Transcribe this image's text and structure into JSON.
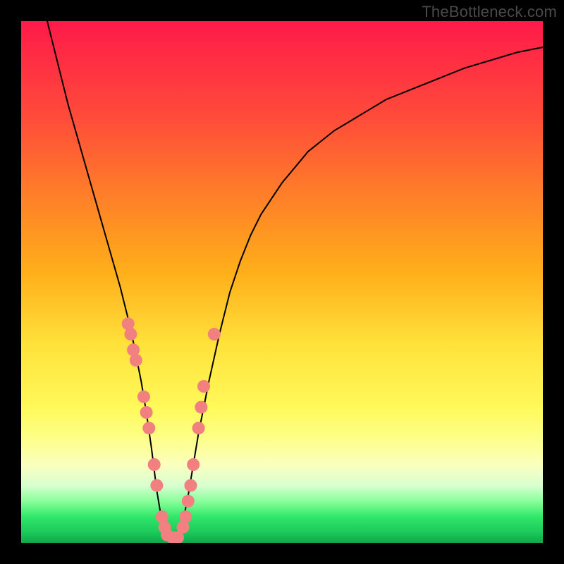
{
  "watermark": "TheBottleneck.com",
  "chart_data": {
    "type": "line",
    "title": "",
    "xlabel": "",
    "ylabel": "",
    "xlim": [
      0,
      100
    ],
    "ylim": [
      0,
      100
    ],
    "x": [
      5,
      7,
      9,
      11,
      13,
      15,
      17,
      19,
      20,
      21,
      22,
      23,
      24,
      25,
      26,
      27,
      28,
      29,
      30,
      31,
      32,
      33,
      34,
      36,
      38,
      40,
      42,
      44,
      46,
      50,
      55,
      60,
      65,
      70,
      75,
      80,
      85,
      90,
      95,
      100
    ],
    "y": [
      100,
      92,
      84,
      77,
      70,
      63,
      56,
      49,
      45,
      41,
      36,
      31,
      25,
      18,
      10,
      4,
      1,
      0.5,
      1,
      4,
      9,
      15,
      21,
      31,
      40,
      48,
      54,
      59,
      63,
      69,
      75,
      79,
      82,
      85,
      87,
      89,
      91,
      92.5,
      94,
      95
    ],
    "markers": {
      "x": [
        20.5,
        21,
        21.5,
        22,
        23.5,
        24,
        24.5,
        25.5,
        26,
        27,
        27.5,
        28,
        29,
        30,
        31,
        31.5,
        32,
        32.5,
        33,
        34,
        34.5,
        35,
        37
      ],
      "y": [
        42,
        40,
        37,
        35,
        28,
        25,
        22,
        15,
        11,
        5,
        3,
        1.5,
        1,
        1,
        3,
        5,
        8,
        11,
        15,
        22,
        26,
        30,
        40
      ]
    },
    "marker_color": "#f28080",
    "curve_color": "#000000"
  }
}
